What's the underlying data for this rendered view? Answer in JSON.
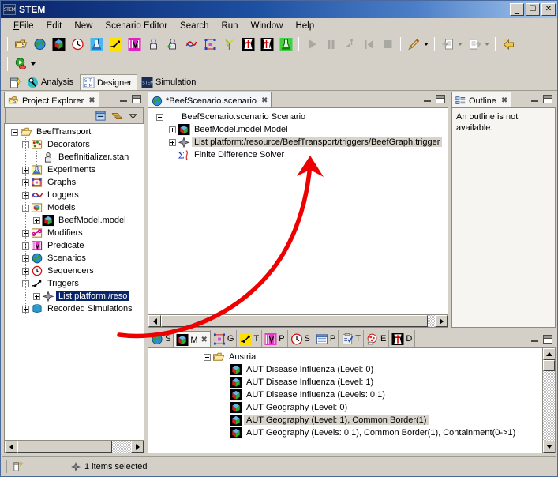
{
  "window": {
    "title": "STEM",
    "app_icon": "stem-logo-icon",
    "minimize_label": "_",
    "maximize_label": "☐",
    "close_label": "✕"
  },
  "menubar": {
    "items": [
      {
        "label": "File",
        "mnemonic": "F"
      },
      {
        "label": "Edit",
        "mnemonic": "E"
      },
      {
        "label": "New",
        "mnemonic": ""
      },
      {
        "label": "Scenario Editor",
        "mnemonic": "S"
      },
      {
        "label": "Search",
        "mnemonic": "a"
      },
      {
        "label": "Run",
        "mnemonic": "R"
      },
      {
        "label": "Window",
        "mnemonic": "W"
      },
      {
        "label": "Help",
        "mnemonic": "H"
      }
    ]
  },
  "toolbar": {
    "row1": [
      {
        "name": "new-project-icon",
        "enabled": true
      },
      {
        "name": "new-scenario-icon",
        "enabled": true
      },
      {
        "name": "new-model-icon",
        "enabled": true
      },
      {
        "name": "new-sequencer-icon",
        "enabled": true
      },
      {
        "name": "new-experiment-icon",
        "enabled": true
      },
      {
        "name": "new-trigger-icon",
        "enabled": true
      },
      {
        "name": "new-predicate-icon",
        "enabled": true
      },
      {
        "name": "new-population-icon",
        "enabled": true
      },
      {
        "name": "new-population-model-icon",
        "enabled": true
      },
      {
        "name": "new-logger-icon",
        "enabled": true
      },
      {
        "name": "new-graph-icon",
        "enabled": true
      },
      {
        "name": "new-food-production-icon",
        "enabled": true
      },
      {
        "name": "new-disease-icon",
        "enabled": true
      },
      {
        "name": "new-disease-infector-icon",
        "enabled": true
      },
      {
        "name": "new-recipe-icon",
        "enabled": true
      }
    ],
    "run_controls": [
      {
        "name": "run-icon",
        "enabled": false
      },
      {
        "name": "pause-icon",
        "enabled": false
      },
      {
        "name": "step-icon",
        "enabled": false
      },
      {
        "name": "reset-icon",
        "enabled": false
      },
      {
        "name": "stop-icon",
        "enabled": false
      }
    ],
    "right_controls": [
      {
        "name": "paint-brush-icon",
        "enabled": true
      },
      {
        "name": "import-icon",
        "enabled": false
      },
      {
        "name": "export-icon",
        "enabled": false
      },
      {
        "name": "back-navigate-icon",
        "enabled": true
      }
    ],
    "row2": [
      {
        "name": "run-scenario-icon",
        "enabled": true
      }
    ]
  },
  "perspectives": {
    "new_icon": "new-perspective-icon",
    "tabs": [
      {
        "label": "Analysis",
        "icon": "analysis-icon",
        "active": false
      },
      {
        "label": "Designer",
        "icon": "designer-icon",
        "active": true
      },
      {
        "label": "Simulation",
        "icon": "simulation-icon",
        "active": false
      }
    ]
  },
  "project_explorer": {
    "tab_label": "Project Explorer",
    "tab_icon": "project-explorer-icon",
    "close_label": "✖",
    "toolbar": [
      {
        "name": "collapse-all-icon"
      },
      {
        "name": "link-with-editor-icon"
      },
      {
        "name": "view-menu-icon"
      }
    ],
    "tree": [
      {
        "label": "BeefTransport",
        "depth": 0,
        "expander": "minus",
        "icon": "open-folder-icon",
        "selected": "none"
      },
      {
        "label": "Decorators",
        "depth": 1,
        "expander": "minus",
        "icon": "decorators-icon",
        "selected": "none"
      },
      {
        "label": "BeefInitializer.stan",
        "depth": 2,
        "expander": "none",
        "icon": "initializer-icon",
        "selected": "none"
      },
      {
        "label": "Experiments",
        "depth": 1,
        "expander": "plus",
        "icon": "experiments-icon",
        "selected": "none"
      },
      {
        "label": "Graphs",
        "depth": 1,
        "expander": "plus",
        "icon": "graphs-icon",
        "selected": "none"
      },
      {
        "label": "Loggers",
        "depth": 1,
        "expander": "plus",
        "icon": "loggers-icon",
        "selected": "none"
      },
      {
        "label": "Models",
        "depth": 1,
        "expander": "minus",
        "icon": "models-icon",
        "selected": "none"
      },
      {
        "label": "BeefModel.model",
        "depth": 2,
        "expander": "plus",
        "icon": "model-icon",
        "selected": "none"
      },
      {
        "label": "Modifiers",
        "depth": 1,
        "expander": "plus",
        "icon": "modifiers-icon",
        "selected": "none"
      },
      {
        "label": "Predicate",
        "depth": 1,
        "expander": "plus",
        "icon": "predicate-icon",
        "selected": "none"
      },
      {
        "label": "Scenarios",
        "depth": 1,
        "expander": "plus",
        "icon": "scenarios-icon",
        "selected": "none"
      },
      {
        "label": "Sequencers",
        "depth": 1,
        "expander": "plus",
        "icon": "sequencers-icon",
        "selected": "none"
      },
      {
        "label": "Triggers",
        "depth": 1,
        "expander": "minus",
        "icon": "triggers-icon",
        "selected": "none"
      },
      {
        "label": "List platform:/reso",
        "depth": 2,
        "expander": "plus",
        "icon": "trigger-item-icon",
        "selected": "blue"
      },
      {
        "label": "Recorded Simulations",
        "depth": 1,
        "expander": "plus",
        "icon": "recorded-sims-icon",
        "selected": "none"
      }
    ]
  },
  "editor": {
    "tab_label": "*BeefScenario.scenario",
    "tab_icon": "scenario-icon",
    "close_label": "✖",
    "tree": [
      {
        "label": "BeefScenario.scenario Scenario",
        "depth": 0,
        "expander": "minus",
        "icon": "scenario-icon",
        "selected": "none"
      },
      {
        "label": "BeefModel.model Model",
        "depth": 1,
        "expander": "plus",
        "icon": "model-icon",
        "selected": "none"
      },
      {
        "label": "List platform:/resource/BeefTransport/triggers/BeefGraph.trigger",
        "depth": 1,
        "expander": "plus",
        "icon": "trigger-item-icon",
        "selected": "gray"
      },
      {
        "label": "Finite Difference Solver",
        "depth": 1,
        "expander": "none",
        "icon": "solver-sigma-icon",
        "selected": "none"
      }
    ]
  },
  "outline": {
    "tab_label": "Outline",
    "tab_icon": "outline-icon",
    "close_label": "✖",
    "message": "An outline is not available."
  },
  "bottom_view": {
    "tabs": [
      {
        "label": "S",
        "icon": "scenarios-tab-icon",
        "active": false
      },
      {
        "label": "M",
        "icon": "models-tab-icon",
        "active": true
      },
      {
        "label": "G",
        "icon": "graphs-tab-icon",
        "active": false
      },
      {
        "label": "T",
        "icon": "triggers-tab-icon",
        "active": false
      },
      {
        "label": "P",
        "icon": "predicates-tab-icon",
        "active": false
      },
      {
        "label": "S",
        "icon": "sequencers-tab-icon",
        "active": false
      },
      {
        "label": "P",
        "icon": "populations-tab-icon",
        "active": false
      },
      {
        "label": "T",
        "icon": "tests-tab-icon",
        "active": false
      },
      {
        "label": "E",
        "icon": "experiments-tab-icon",
        "active": false
      },
      {
        "label": "D",
        "icon": "diseases-tab-icon",
        "active": false
      }
    ],
    "close_label": "✖",
    "tree": [
      {
        "label": "Austria",
        "depth": 0,
        "expander": "minus",
        "icon": "open-folder-icon",
        "selected": "none"
      },
      {
        "label": "AUT Disease Influenza (Level: 0)",
        "depth": 1,
        "expander": "none",
        "icon": "model-icon",
        "selected": "none"
      },
      {
        "label": "AUT Disease Influenza (Level: 1)",
        "depth": 1,
        "expander": "none",
        "icon": "model-icon",
        "selected": "none"
      },
      {
        "label": "AUT Disease Influenza (Levels: 0,1)",
        "depth": 1,
        "expander": "none",
        "icon": "model-icon",
        "selected": "none"
      },
      {
        "label": "AUT Geography (Level: 0)",
        "depth": 1,
        "expander": "none",
        "icon": "model-icon",
        "selected": "none"
      },
      {
        "label": "AUT Geography (Level: 1), Common Border(1)",
        "depth": 1,
        "expander": "none",
        "icon": "model-icon",
        "selected": "gray"
      },
      {
        "label": "AUT Geography (Levels: 0,1), Common Border(1), Containment(0->1)",
        "depth": 1,
        "expander": "none",
        "icon": "model-icon",
        "selected": "none"
      }
    ]
  },
  "statusbar": {
    "icon": "selection-mode-icon",
    "selection_icon": "diamond-icon",
    "text": "1 items selected"
  },
  "annotation": {
    "arrow_color": "#ee0000",
    "arrow_name": "red-curved-arrow-annotation"
  }
}
